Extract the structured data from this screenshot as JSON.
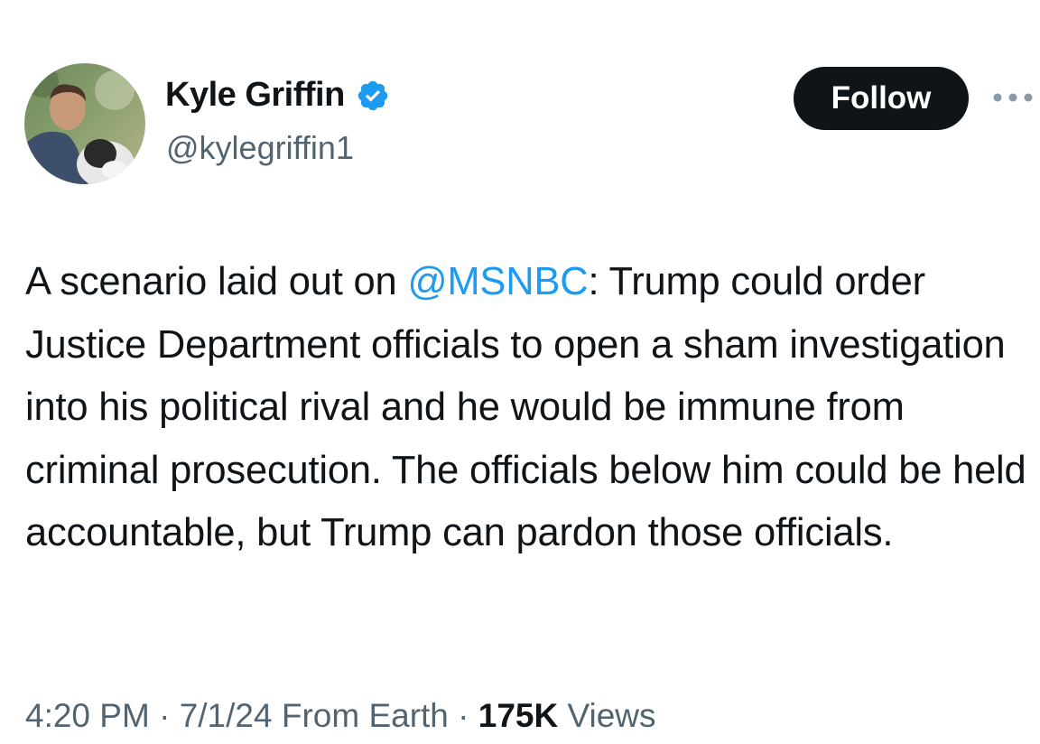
{
  "author": {
    "display_name": "Kyle Griffin",
    "handle": "@kylegriffin1",
    "verified": true,
    "verified_color": "#1d9bf0",
    "avatar_icon": "profile-photo-man-with-dog"
  },
  "actions": {
    "follow_label": "Follow",
    "more_icon": "more-dots-icon"
  },
  "tweet": {
    "text_before": "A scenario laid out on ",
    "mention": "@MSNBC",
    "text_after": ": Trump could order Justice Department officials to open a sham investigation into his political rival and he would be immune from criminal prosecution. The officials below him could be held accountable, but Trump can pardon those officials."
  },
  "meta": {
    "time": "4:20 PM",
    "separator": " · ",
    "date_location": "7/1/24 From Earth",
    "views_count": "175K",
    "views_label": " Views"
  },
  "colors": {
    "text": "#0f1419",
    "secondary": "#536471",
    "link": "#1d9bf0",
    "button_bg": "#0f1419"
  }
}
